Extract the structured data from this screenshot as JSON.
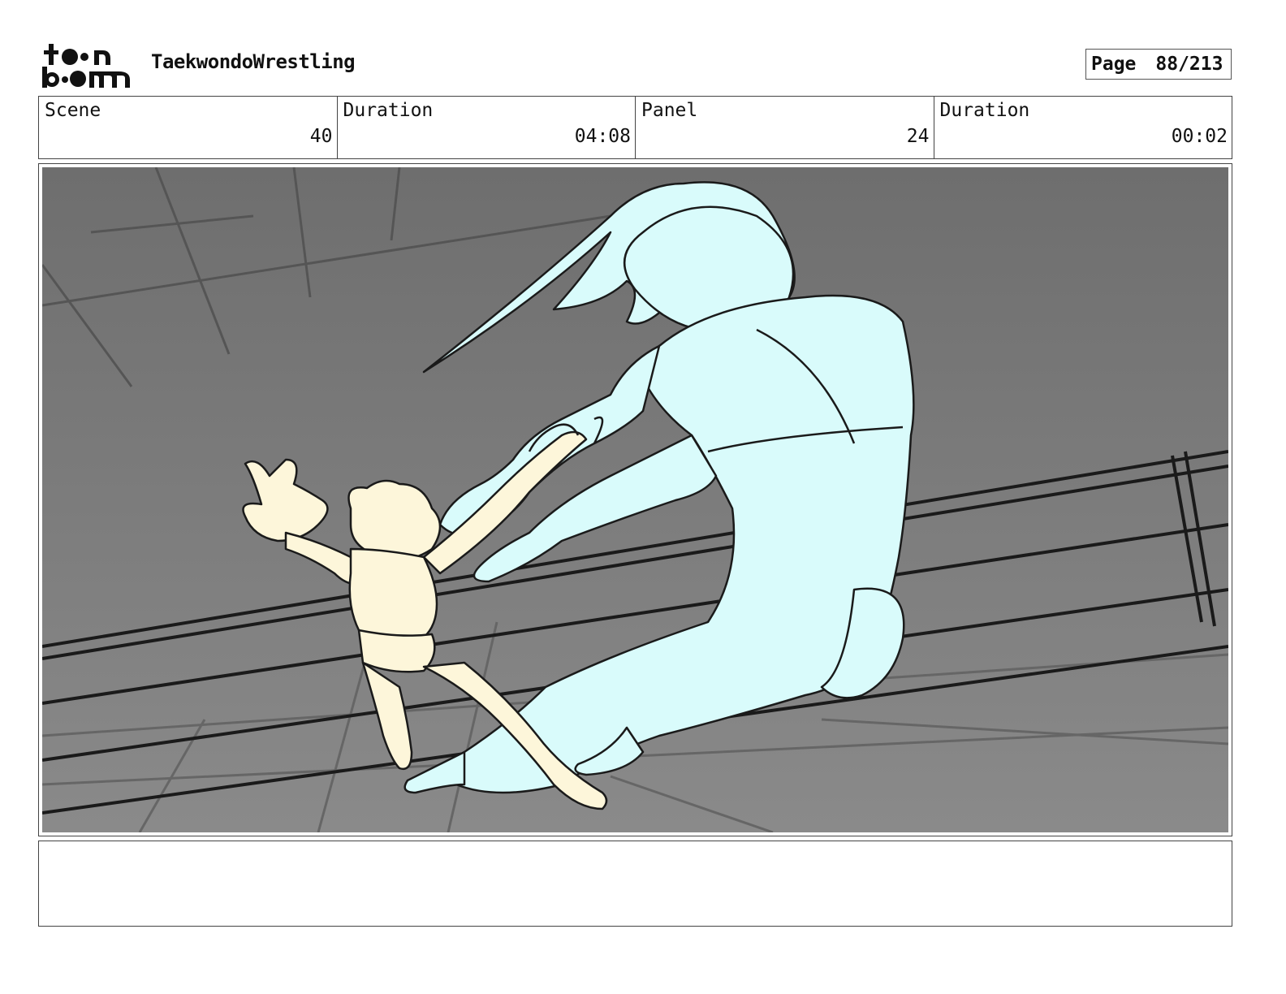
{
  "header": {
    "logo_text": "toon boom",
    "project_title": "TaekwondoWrestling",
    "page_label": "Page",
    "page_value": "88/213"
  },
  "info": {
    "scene_label": "Scene",
    "scene_value": "40",
    "scene_duration_label": "Duration",
    "scene_duration_value": "04:08",
    "panel_label": "Panel",
    "panel_value": "24",
    "panel_duration_label": "Duration",
    "panel_duration_value": "00:02"
  },
  "panel": {
    "background_color": "#7c7c7c",
    "blue_figure_color": "#d9fbfb",
    "small_figure_color": "#fdf6da",
    "line_color": "#1a1a1a"
  },
  "notes": {
    "text": ""
  }
}
